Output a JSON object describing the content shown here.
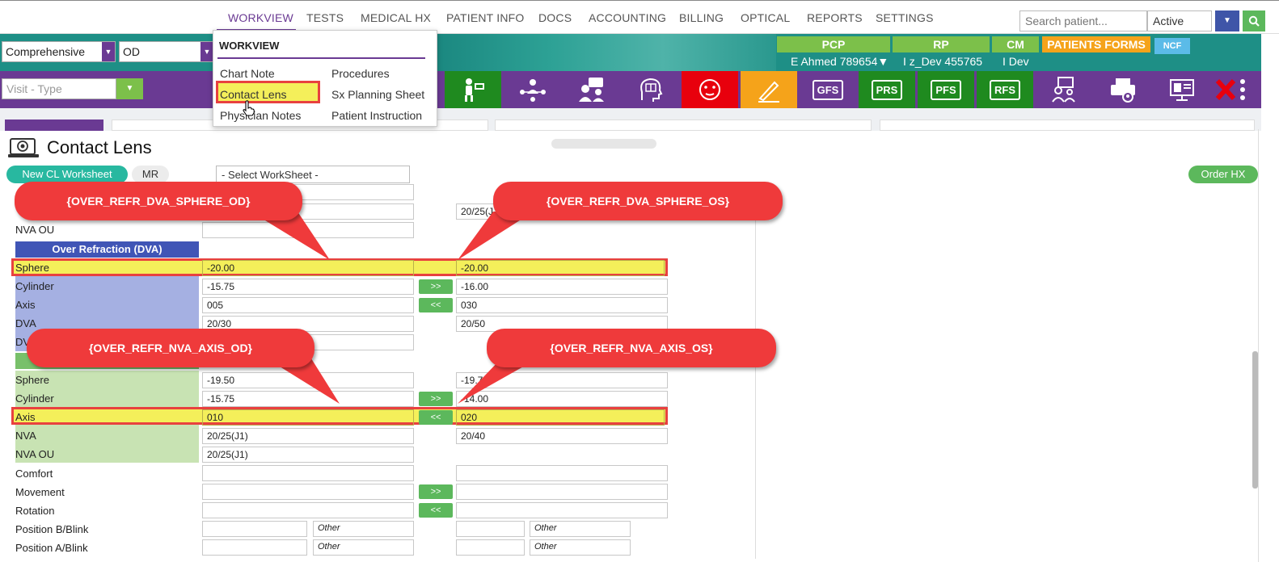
{
  "nav": {
    "items": [
      "WORKVIEW",
      "TESTS",
      "MEDICAL HX",
      "PATIENT INFO",
      "DOCS",
      "ACCOUNTING",
      "BILLING",
      "OPTICAL",
      "REPORTS",
      "SETTINGS"
    ],
    "search_placeholder": "Search patient...",
    "status_value": "Active"
  },
  "header": {
    "exam_type": "Comprehensive",
    "eye": "OD",
    "pcp_label": "PCP",
    "rp_label": "RP",
    "cm_label": "CM",
    "forms_label": "PATIENTS FORMS",
    "ncf_label": "NCF",
    "pcp_value": "E Ahmed 789654▼",
    "rp_value": "I z_Dev 455765",
    "cm_value": "I Dev",
    "visit_placeholder": "Visit - Type"
  },
  "toolbar": {
    "gfs": "GFS",
    "prs": "PRS",
    "pfs": "PFS",
    "rfs": "RFS"
  },
  "dropdown": {
    "title": "WORKVIEW",
    "items": [
      "Chart Note",
      "Contact Lens",
      "Physician Notes",
      "Procedures",
      "Sx Planning Sheet",
      "Patient Instruction"
    ]
  },
  "page": {
    "title": "Contact Lens",
    "new_cl": "New CL Worksheet",
    "mr": "MR",
    "worksheet": "- Select WorkSheet -",
    "order_hx": "Order HX"
  },
  "form": {
    "nva_ou": "NVA OU",
    "dva_section": "Over Refraction (DVA)",
    "top_os_value": "20/25(J",
    "dva": [
      {
        "label": "Sphere",
        "od": "-20.00",
        "os": "-20.00"
      },
      {
        "label": "Cylinder",
        "od": "-15.75",
        "os": "-16.00",
        "arrow": ">>"
      },
      {
        "label": "Axis",
        "od": "005",
        "os": "030",
        "arrow": "<<"
      },
      {
        "label": "DVA",
        "od": "20/30",
        "os": "20/50"
      },
      {
        "label": "DV",
        "od": "",
        "os": ""
      }
    ],
    "nva": [
      {
        "label": "Sphere",
        "od": "-19.50",
        "os": "-19.7"
      },
      {
        "label": "Cylinder",
        "od": "-15.75",
        "os": "-14.00",
        "arrow": ">>"
      },
      {
        "label": "Axis",
        "od": "010",
        "os": "020",
        "arrow": "<<"
      },
      {
        "label": "NVA",
        "od": "20/25(J1)",
        "os": "20/40"
      },
      {
        "label": "NVA OU",
        "od": "20/25(J1)"
      }
    ],
    "fit": [
      {
        "label": "Comfort"
      },
      {
        "label": "Movement",
        "arrow": ">>"
      },
      {
        "label": "Rotation",
        "arrow": "<<"
      },
      {
        "label": "Position B/Blink",
        "other": "Other"
      },
      {
        "label": "Position A/Blink",
        "other": "Other"
      }
    ]
  },
  "callouts": [
    "{OVER_REFR_DVA_SPHERE_OD}",
    "{OVER_REFR_DVA_SPHERE_OS}",
    "{OVER_REFR_NVA_AXIS_OD}",
    "{OVER_REFR_NVA_AXIS_OS}"
  ],
  "colors": {
    "purple": "#6a3a93",
    "teal": "#1e8f86",
    "green": "#7cc04a",
    "callout": "#ef3a3b",
    "highlight": "#f4ef5a"
  }
}
